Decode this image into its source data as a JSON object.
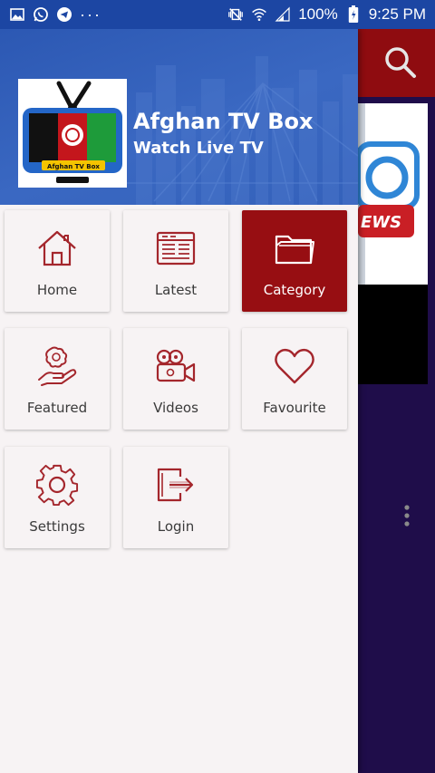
{
  "status_bar": {
    "battery": "100%",
    "time": "9:25 PM",
    "left_icons": [
      "gallery-icon",
      "whatsapp-icon",
      "telegram-icon",
      "more-dots-icon"
    ],
    "right_icons": [
      "mute-vibrate-icon",
      "wifi-icon",
      "signal-icon",
      "battery-icon"
    ]
  },
  "drawer": {
    "app_title": "Afghan TV Box",
    "app_subtitle": "Watch Live TV",
    "logo_text": "Afghan TV Box",
    "menu": [
      {
        "label": "Home",
        "icon": "home-icon",
        "active": false
      },
      {
        "label": "Latest",
        "icon": "newspaper-icon",
        "active": false
      },
      {
        "label": "Category",
        "icon": "folder-icon",
        "active": true
      },
      {
        "label": "Featured",
        "icon": "hand-star-icon",
        "active": false
      },
      {
        "label": "Videos",
        "icon": "video-camera-icon",
        "active": false
      },
      {
        "label": "Favourite",
        "icon": "heart-icon",
        "active": false
      },
      {
        "label": "Settings",
        "icon": "gear-icon",
        "active": false
      },
      {
        "label": "Login",
        "icon": "login-icon",
        "active": false
      }
    ]
  },
  "background": {
    "card_text": "EWS"
  },
  "colors": {
    "header_blue": "#2c58b3",
    "accent_red": "#970e12",
    "icon_red": "#a4262c",
    "drawer_bg": "#f7f3f4",
    "bg_purple": "#1f0d4a"
  }
}
